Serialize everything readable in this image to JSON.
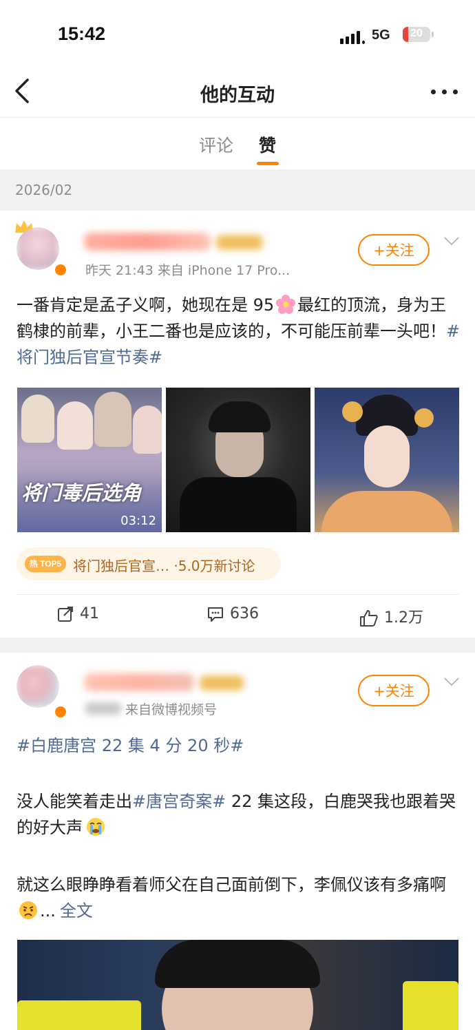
{
  "status": {
    "time": "15:42",
    "network": "5G",
    "battery": "20",
    "battery_level": 0.2
  },
  "nav": {
    "title": "他的互动"
  },
  "tabs": [
    {
      "label": "评论"
    },
    {
      "label": "赞"
    }
  ],
  "date_group": "2026/02",
  "post1": {
    "meta": "昨天 21:43  来自 iPhone 17 Pro...",
    "follow": "+关注",
    "text_pre": "一番肯定是孟子义啊，她现在是 95",
    "text_mid": "最红的顶流，身为王鹤棣的前辈，小王二番也是应该的，不可能压前辈一头吧！",
    "hashtag": "#将门独后官宣节奏#",
    "video_caption": "将门毒后选角",
    "video_duration": "03:12",
    "hot_badge": "热 TOP5",
    "hot_text": "将门独后官宣… ·5.0万新讨论",
    "repost_count": "41",
    "comment_count": "636",
    "like_count": "1.2万"
  },
  "post2": {
    "meta_source": "来自微博视频号",
    "follow": "+关注",
    "hashtag_line": "#白鹿唐宫 22 集 4 分 20 秒#",
    "p1_pre": "没人能笑着走出",
    "p1_tag": "#唐宫奇案#",
    "p1_post": " 22 集这段，白鹿哭我也跟着哭的好大声",
    "p2": "就这么眼睁睁看着师父在自己面前倒下，李佩仪该有多痛啊",
    "ellipsis": "...",
    "full_text": "全文"
  },
  "colors": {
    "accent": "#ff8200",
    "link": "#4e6a95",
    "hot_bg": "#fff5e6"
  }
}
